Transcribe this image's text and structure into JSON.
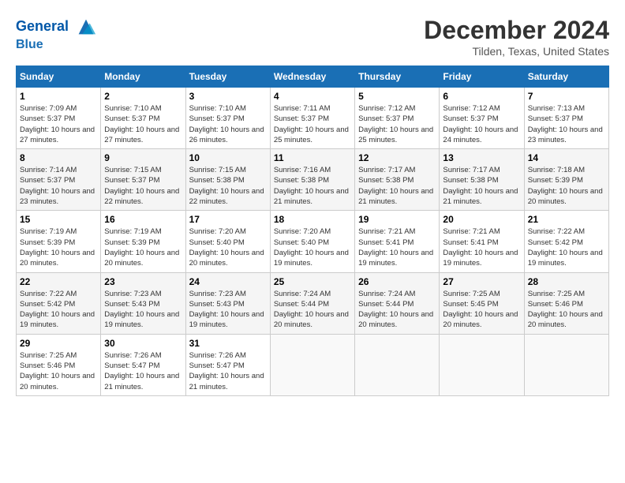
{
  "header": {
    "logo_line1": "General",
    "logo_line2": "Blue",
    "month": "December 2024",
    "location": "Tilden, Texas, United States"
  },
  "weekdays": [
    "Sunday",
    "Monday",
    "Tuesday",
    "Wednesday",
    "Thursday",
    "Friday",
    "Saturday"
  ],
  "weeks": [
    [
      {
        "day": "1",
        "sunrise": "Sunrise: 7:09 AM",
        "sunset": "Sunset: 5:37 PM",
        "daylight": "Daylight: 10 hours and 27 minutes."
      },
      {
        "day": "2",
        "sunrise": "Sunrise: 7:10 AM",
        "sunset": "Sunset: 5:37 PM",
        "daylight": "Daylight: 10 hours and 27 minutes."
      },
      {
        "day": "3",
        "sunrise": "Sunrise: 7:10 AM",
        "sunset": "Sunset: 5:37 PM",
        "daylight": "Daylight: 10 hours and 26 minutes."
      },
      {
        "day": "4",
        "sunrise": "Sunrise: 7:11 AM",
        "sunset": "Sunset: 5:37 PM",
        "daylight": "Daylight: 10 hours and 25 minutes."
      },
      {
        "day": "5",
        "sunrise": "Sunrise: 7:12 AM",
        "sunset": "Sunset: 5:37 PM",
        "daylight": "Daylight: 10 hours and 25 minutes."
      },
      {
        "day": "6",
        "sunrise": "Sunrise: 7:12 AM",
        "sunset": "Sunset: 5:37 PM",
        "daylight": "Daylight: 10 hours and 24 minutes."
      },
      {
        "day": "7",
        "sunrise": "Sunrise: 7:13 AM",
        "sunset": "Sunset: 5:37 PM",
        "daylight": "Daylight: 10 hours and 23 minutes."
      }
    ],
    [
      {
        "day": "8",
        "sunrise": "Sunrise: 7:14 AM",
        "sunset": "Sunset: 5:37 PM",
        "daylight": "Daylight: 10 hours and 23 minutes."
      },
      {
        "day": "9",
        "sunrise": "Sunrise: 7:15 AM",
        "sunset": "Sunset: 5:37 PM",
        "daylight": "Daylight: 10 hours and 22 minutes."
      },
      {
        "day": "10",
        "sunrise": "Sunrise: 7:15 AM",
        "sunset": "Sunset: 5:38 PM",
        "daylight": "Daylight: 10 hours and 22 minutes."
      },
      {
        "day": "11",
        "sunrise": "Sunrise: 7:16 AM",
        "sunset": "Sunset: 5:38 PM",
        "daylight": "Daylight: 10 hours and 21 minutes."
      },
      {
        "day": "12",
        "sunrise": "Sunrise: 7:17 AM",
        "sunset": "Sunset: 5:38 PM",
        "daylight": "Daylight: 10 hours and 21 minutes."
      },
      {
        "day": "13",
        "sunrise": "Sunrise: 7:17 AM",
        "sunset": "Sunset: 5:38 PM",
        "daylight": "Daylight: 10 hours and 21 minutes."
      },
      {
        "day": "14",
        "sunrise": "Sunrise: 7:18 AM",
        "sunset": "Sunset: 5:39 PM",
        "daylight": "Daylight: 10 hours and 20 minutes."
      }
    ],
    [
      {
        "day": "15",
        "sunrise": "Sunrise: 7:19 AM",
        "sunset": "Sunset: 5:39 PM",
        "daylight": "Daylight: 10 hours and 20 minutes."
      },
      {
        "day": "16",
        "sunrise": "Sunrise: 7:19 AM",
        "sunset": "Sunset: 5:39 PM",
        "daylight": "Daylight: 10 hours and 20 minutes."
      },
      {
        "day": "17",
        "sunrise": "Sunrise: 7:20 AM",
        "sunset": "Sunset: 5:40 PM",
        "daylight": "Daylight: 10 hours and 20 minutes."
      },
      {
        "day": "18",
        "sunrise": "Sunrise: 7:20 AM",
        "sunset": "Sunset: 5:40 PM",
        "daylight": "Daylight: 10 hours and 19 minutes."
      },
      {
        "day": "19",
        "sunrise": "Sunrise: 7:21 AM",
        "sunset": "Sunset: 5:41 PM",
        "daylight": "Daylight: 10 hours and 19 minutes."
      },
      {
        "day": "20",
        "sunrise": "Sunrise: 7:21 AM",
        "sunset": "Sunset: 5:41 PM",
        "daylight": "Daylight: 10 hours and 19 minutes."
      },
      {
        "day": "21",
        "sunrise": "Sunrise: 7:22 AM",
        "sunset": "Sunset: 5:42 PM",
        "daylight": "Daylight: 10 hours and 19 minutes."
      }
    ],
    [
      {
        "day": "22",
        "sunrise": "Sunrise: 7:22 AM",
        "sunset": "Sunset: 5:42 PM",
        "daylight": "Daylight: 10 hours and 19 minutes."
      },
      {
        "day": "23",
        "sunrise": "Sunrise: 7:23 AM",
        "sunset": "Sunset: 5:43 PM",
        "daylight": "Daylight: 10 hours and 19 minutes."
      },
      {
        "day": "24",
        "sunrise": "Sunrise: 7:23 AM",
        "sunset": "Sunset: 5:43 PM",
        "daylight": "Daylight: 10 hours and 19 minutes."
      },
      {
        "day": "25",
        "sunrise": "Sunrise: 7:24 AM",
        "sunset": "Sunset: 5:44 PM",
        "daylight": "Daylight: 10 hours and 20 minutes."
      },
      {
        "day": "26",
        "sunrise": "Sunrise: 7:24 AM",
        "sunset": "Sunset: 5:44 PM",
        "daylight": "Daylight: 10 hours and 20 minutes."
      },
      {
        "day": "27",
        "sunrise": "Sunrise: 7:25 AM",
        "sunset": "Sunset: 5:45 PM",
        "daylight": "Daylight: 10 hours and 20 minutes."
      },
      {
        "day": "28",
        "sunrise": "Sunrise: 7:25 AM",
        "sunset": "Sunset: 5:46 PM",
        "daylight": "Daylight: 10 hours and 20 minutes."
      }
    ],
    [
      {
        "day": "29",
        "sunrise": "Sunrise: 7:25 AM",
        "sunset": "Sunset: 5:46 PM",
        "daylight": "Daylight: 10 hours and 20 minutes."
      },
      {
        "day": "30",
        "sunrise": "Sunrise: 7:26 AM",
        "sunset": "Sunset: 5:47 PM",
        "daylight": "Daylight: 10 hours and 21 minutes."
      },
      {
        "day": "31",
        "sunrise": "Sunrise: 7:26 AM",
        "sunset": "Sunset: 5:47 PM",
        "daylight": "Daylight: 10 hours and 21 minutes."
      },
      null,
      null,
      null,
      null
    ]
  ]
}
